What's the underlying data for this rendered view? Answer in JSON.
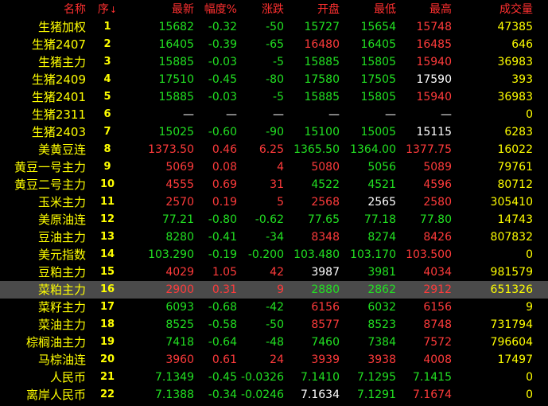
{
  "header": {
    "name": "名称",
    "seq": "序",
    "sort_arrow": "↓",
    "latest": "最新",
    "pct": "幅度%",
    "chg": "涨跌",
    "open": "开盘",
    "low": "最低",
    "high": "最高",
    "volume": "成交量"
  },
  "colors": {
    "up": "#ff3b3b",
    "down": "#22e022",
    "flat": "#ffffff",
    "name": "#ffff00",
    "header": "#ff3030",
    "selected_row_bg": "#4a4a4a"
  },
  "selected_index": 15,
  "rows": [
    {
      "name": "生猪加权",
      "seq": "1",
      "latest": "15682",
      "latest_c": "down",
      "pct": "-0.32",
      "pct_c": "down",
      "chg": "-50",
      "chg_c": "down",
      "open": "15727",
      "open_c": "down",
      "low": "15654",
      "low_c": "down",
      "high": "15748",
      "high_c": "up",
      "volume": "47385"
    },
    {
      "name": "生猪2407",
      "seq": "2",
      "latest": "16405",
      "latest_c": "down",
      "pct": "-0.39",
      "pct_c": "down",
      "chg": "-65",
      "chg_c": "down",
      "open": "16480",
      "open_c": "up",
      "low": "16405",
      "low_c": "down",
      "high": "16485",
      "high_c": "up",
      "volume": "646"
    },
    {
      "name": "生猪主力",
      "seq": "3",
      "latest": "15885",
      "latest_c": "down",
      "pct": "-0.03",
      "pct_c": "down",
      "chg": "-5",
      "chg_c": "down",
      "open": "15885",
      "open_c": "down",
      "low": "15805",
      "low_c": "down",
      "high": "15940",
      "high_c": "up",
      "volume": "36983"
    },
    {
      "name": "生猪2409",
      "seq": "4",
      "latest": "17510",
      "latest_c": "down",
      "pct": "-0.45",
      "pct_c": "down",
      "chg": "-80",
      "chg_c": "down",
      "open": "17580",
      "open_c": "down",
      "low": "17505",
      "low_c": "down",
      "high": "17590",
      "high_c": "flat",
      "volume": "393"
    },
    {
      "name": "生猪2401",
      "seq": "5",
      "latest": "15885",
      "latest_c": "down",
      "pct": "-0.03",
      "pct_c": "down",
      "chg": "-5",
      "chg_c": "down",
      "open": "15885",
      "open_c": "down",
      "low": "15805",
      "low_c": "down",
      "high": "15940",
      "high_c": "up",
      "volume": "36983"
    },
    {
      "name": "生猪2311",
      "seq": "6",
      "latest": "—",
      "latest_c": "flat",
      "pct": "—",
      "pct_c": "flat",
      "chg": "—",
      "chg_c": "flat",
      "open": "—",
      "open_c": "flat",
      "low": "—",
      "low_c": "flat",
      "high": "—",
      "high_c": "flat",
      "volume": "0"
    },
    {
      "name": "生猪2403",
      "seq": "7",
      "latest": "15025",
      "latest_c": "down",
      "pct": "-0.60",
      "pct_c": "down",
      "chg": "-90",
      "chg_c": "down",
      "open": "15100",
      "open_c": "down",
      "low": "15005",
      "low_c": "down",
      "high": "15115",
      "high_c": "flat",
      "volume": "6283"
    },
    {
      "name": "美黄豆连",
      "seq": "8",
      "latest": "1373.50",
      "latest_c": "up",
      "pct": "0.46",
      "pct_c": "up",
      "chg": "6.25",
      "chg_c": "up",
      "open": "1365.50",
      "open_c": "down",
      "low": "1364.00",
      "low_c": "down",
      "high": "1377.75",
      "high_c": "up",
      "volume": "16022"
    },
    {
      "name": "黄豆一号主力",
      "seq": "9",
      "latest": "5069",
      "latest_c": "up",
      "pct": "0.08",
      "pct_c": "up",
      "chg": "4",
      "chg_c": "up",
      "open": "5080",
      "open_c": "up",
      "low": "5056",
      "low_c": "down",
      "high": "5089",
      "high_c": "up",
      "volume": "79761"
    },
    {
      "name": "黄豆二号主力",
      "seq": "10",
      "latest": "4555",
      "latest_c": "up",
      "pct": "0.69",
      "pct_c": "up",
      "chg": "31",
      "chg_c": "up",
      "open": "4522",
      "open_c": "down",
      "low": "4521",
      "low_c": "down",
      "high": "4596",
      "high_c": "up",
      "volume": "80712"
    },
    {
      "name": "玉米主力",
      "seq": "11",
      "latest": "2570",
      "latest_c": "up",
      "pct": "0.19",
      "pct_c": "up",
      "chg": "5",
      "chg_c": "up",
      "open": "2568",
      "open_c": "up",
      "low": "2565",
      "low_c": "flat",
      "high": "2580",
      "high_c": "up",
      "volume": "305410"
    },
    {
      "name": "美原油连",
      "seq": "12",
      "latest": "77.21",
      "latest_c": "down",
      "pct": "-0.80",
      "pct_c": "down",
      "chg": "-0.62",
      "chg_c": "down",
      "open": "77.65",
      "open_c": "down",
      "low": "77.18",
      "low_c": "down",
      "high": "77.80",
      "high_c": "down",
      "volume": "14743"
    },
    {
      "name": "豆油主力",
      "seq": "13",
      "latest": "8280",
      "latest_c": "down",
      "pct": "-0.41",
      "pct_c": "down",
      "chg": "-34",
      "chg_c": "down",
      "open": "8348",
      "open_c": "up",
      "low": "8274",
      "low_c": "down",
      "high": "8426",
      "high_c": "up",
      "volume": "807832"
    },
    {
      "name": "美元指数",
      "seq": "14",
      "latest": "103.290",
      "latest_c": "down",
      "pct": "-0.19",
      "pct_c": "down",
      "chg": "-0.200",
      "chg_c": "down",
      "open": "103.480",
      "open_c": "down",
      "low": "103.170",
      "low_c": "down",
      "high": "103.500",
      "high_c": "up",
      "volume": "0"
    },
    {
      "name": "豆粕主力",
      "seq": "15",
      "latest": "4029",
      "latest_c": "up",
      "pct": "1.05",
      "pct_c": "up",
      "chg": "42",
      "chg_c": "up",
      "open": "3987",
      "open_c": "flat",
      "low": "3981",
      "low_c": "down",
      "high": "4034",
      "high_c": "up",
      "volume": "981579"
    },
    {
      "name": "菜粕主力",
      "seq": "16",
      "latest": "2900",
      "latest_c": "up",
      "pct": "0.31",
      "pct_c": "up",
      "chg": "9",
      "chg_c": "up",
      "open": "2880",
      "open_c": "down",
      "low": "2862",
      "low_c": "down",
      "high": "2912",
      "high_c": "up",
      "volume": "651326"
    },
    {
      "name": "菜籽主力",
      "seq": "17",
      "latest": "6093",
      "latest_c": "down",
      "pct": "-0.68",
      "pct_c": "down",
      "chg": "-42",
      "chg_c": "down",
      "open": "6156",
      "open_c": "up",
      "low": "6032",
      "low_c": "down",
      "high": "6156",
      "high_c": "up",
      "volume": "9"
    },
    {
      "name": "菜油主力",
      "seq": "18",
      "latest": "8525",
      "latest_c": "down",
      "pct": "-0.58",
      "pct_c": "down",
      "chg": "-50",
      "chg_c": "down",
      "open": "8577",
      "open_c": "up",
      "low": "8523",
      "low_c": "down",
      "high": "8748",
      "high_c": "up",
      "volume": "731794"
    },
    {
      "name": "棕榈油主力",
      "seq": "19",
      "latest": "7418",
      "latest_c": "down",
      "pct": "-0.64",
      "pct_c": "down",
      "chg": "-48",
      "chg_c": "down",
      "open": "7460",
      "open_c": "down",
      "low": "7384",
      "low_c": "down",
      "high": "7572",
      "high_c": "up",
      "volume": "796604"
    },
    {
      "name": "马棕油连",
      "seq": "20",
      "latest": "3960",
      "latest_c": "up",
      "pct": "0.61",
      "pct_c": "up",
      "chg": "24",
      "chg_c": "up",
      "open": "3939",
      "open_c": "up",
      "low": "3938",
      "low_c": "up",
      "high": "4008",
      "high_c": "up",
      "volume": "17497"
    },
    {
      "name": "人民币",
      "seq": "21",
      "latest": "7.1349",
      "latest_c": "down",
      "pct": "-0.45",
      "pct_c": "down",
      "chg": "-0.0326",
      "chg_c": "down",
      "open": "7.1410",
      "open_c": "down",
      "low": "7.1295",
      "low_c": "down",
      "high": "7.1415",
      "high_c": "down",
      "volume": "0"
    },
    {
      "name": "离岸人民币",
      "seq": "22",
      "latest": "7.1388",
      "latest_c": "down",
      "pct": "-0.34",
      "pct_c": "down",
      "chg": "-0.0246",
      "chg_c": "down",
      "open": "7.1634",
      "open_c": "flat",
      "low": "7.1291",
      "low_c": "down",
      "high": "7.1674",
      "high_c": "up",
      "volume": "0"
    }
  ]
}
